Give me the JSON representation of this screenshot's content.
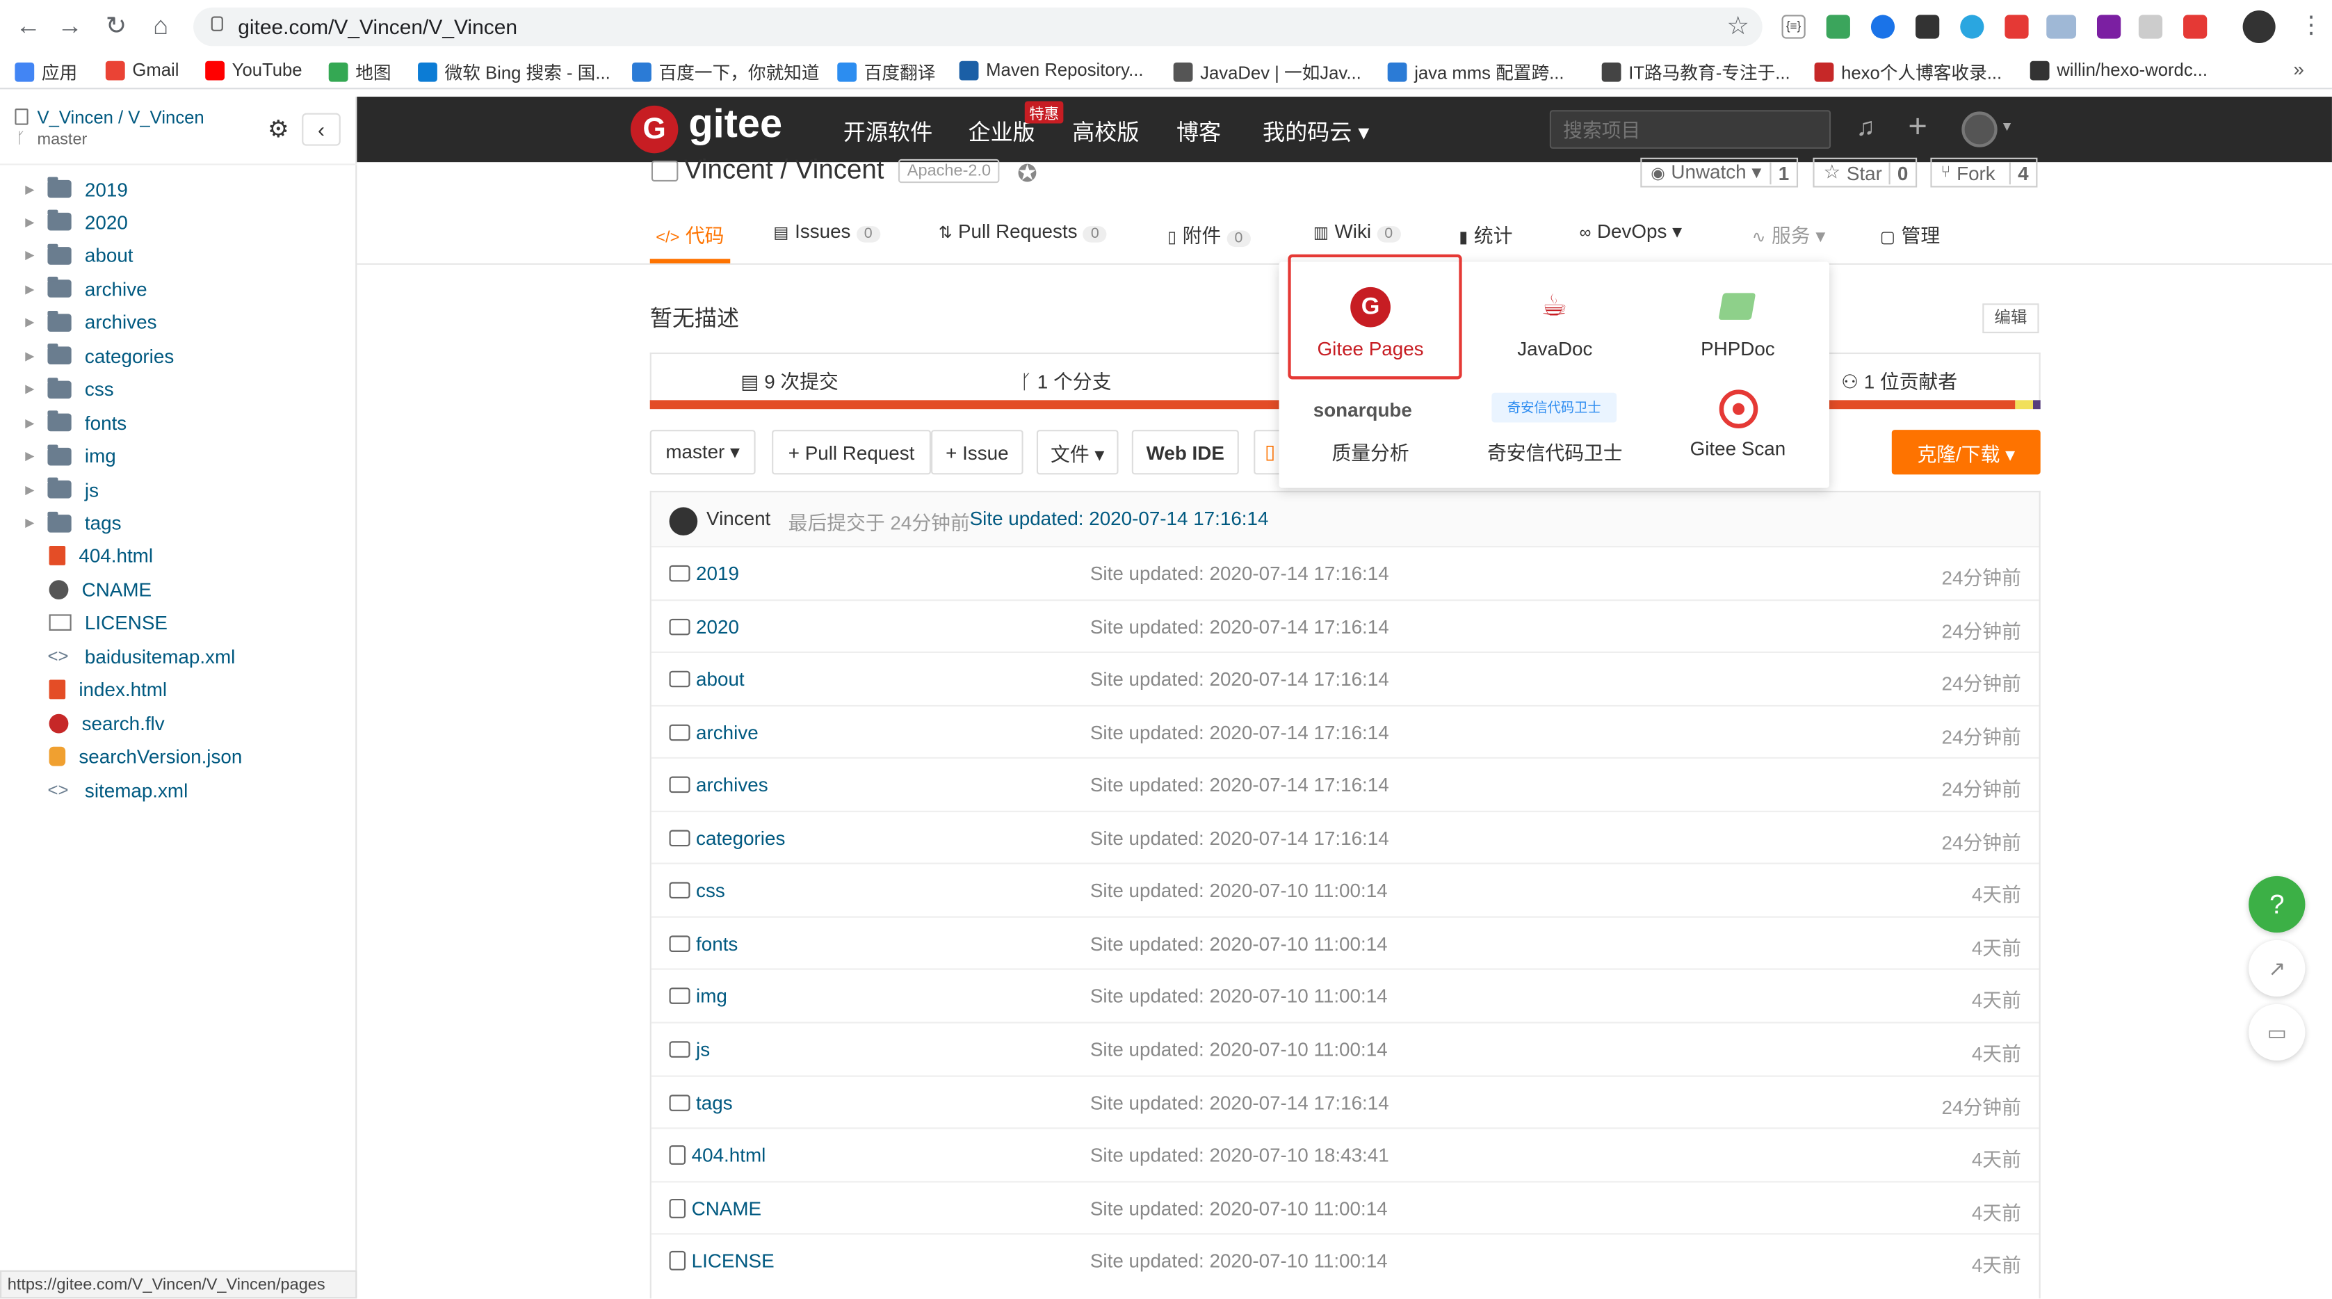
{
  "browser": {
    "url": "gitee.com/V_Vincen/V_Vincen",
    "status_url": "https://gitee.com/V_Vincen/V_Vincen/pages",
    "bookmarks": [
      "应用",
      "Gmail",
      "YouTube",
      "地图",
      "微软 Bing 搜索 - 国...",
      "百度一下，你就知道",
      "百度翻译",
      "Maven Repository...",
      "JavaDev | 一如Jav...",
      "java mms 配置跨...",
      "IT路马教育-专注于...",
      "hexo个人博客收录...",
      "willin/hexo-wordc..."
    ],
    "more": "»"
  },
  "sidebar": {
    "repo_path": "V_Vincen / V_Vincen",
    "branch": "master",
    "tree": [
      {
        "name": "2019",
        "type": "folder"
      },
      {
        "name": "2020",
        "type": "folder"
      },
      {
        "name": "about",
        "type": "folder"
      },
      {
        "name": "archive",
        "type": "folder"
      },
      {
        "name": "archives",
        "type": "folder"
      },
      {
        "name": "categories",
        "type": "folder"
      },
      {
        "name": "css",
        "type": "folder"
      },
      {
        "name": "fonts",
        "type": "folder"
      },
      {
        "name": "img",
        "type": "folder"
      },
      {
        "name": "js",
        "type": "folder"
      },
      {
        "name": "tags",
        "type": "folder"
      },
      {
        "name": "404.html",
        "type": "html"
      },
      {
        "name": "CNAME",
        "type": "globe"
      },
      {
        "name": "LICENSE",
        "type": "book"
      },
      {
        "name": "baidusitemap.xml",
        "type": "code"
      },
      {
        "name": "index.html",
        "type": "html"
      },
      {
        "name": "search.flv",
        "type": "media"
      },
      {
        "name": "searchVersion.json",
        "type": "db"
      },
      {
        "name": "sitemap.xml",
        "type": "code"
      }
    ]
  },
  "header": {
    "logo": "gitee",
    "nav": [
      "开源软件",
      "企业版",
      "高校版",
      "博客",
      "我的码云 ▾"
    ],
    "promo_badge": "特惠",
    "search_placeholder": "搜索项目"
  },
  "project": {
    "title": "Vincent / Vincent",
    "license": "Apache-2.0",
    "unwatch": "Unwatch ▾",
    "unwatch_count": "1",
    "star": "Star",
    "star_count": "0",
    "fork": "Fork",
    "fork_count": "4",
    "tabs": [
      {
        "label": "代码",
        "count": ""
      },
      {
        "label": "Issues",
        "count": "0"
      },
      {
        "label": "Pull Requests",
        "count": "0"
      },
      {
        "label": "附件",
        "count": "0"
      },
      {
        "label": "Wiki",
        "count": "0"
      },
      {
        "label": "统计",
        "count": ""
      },
      {
        "label": "DevOps ▾",
        "count": ""
      },
      {
        "label": "服务 ▾",
        "count": ""
      },
      {
        "label": "管理",
        "count": ""
      }
    ],
    "description": "暂无描述",
    "edit": "编辑",
    "commits": "9 次提交",
    "branches": "1 个分支",
    "contributors": "1 位贡献者",
    "branch_select": "master ▾",
    "pull_request_btn": "+ Pull Request",
    "issue_btn": "+ Issue",
    "files_btn": "文件 ▾",
    "webide_btn": "Web IDE",
    "clone_btn": "克隆/下载 ▾"
  },
  "dropdown": {
    "items": [
      {
        "label": "Gitee Pages",
        "selected": true
      },
      {
        "label": "JavaDoc"
      },
      {
        "label": "PHPDoc"
      },
      {
        "label": "质量分析",
        "logo": "sonarqube"
      },
      {
        "label": "奇安信代码卫士",
        "logo": "奇安信代码卫士"
      },
      {
        "label": "Gitee Scan"
      }
    ]
  },
  "commit": {
    "author": "Vincent",
    "text": "最后提交于 24分钟前",
    "message": "Site updated: 2020-07-14 17:16:14"
  },
  "files": [
    {
      "name": "2019",
      "type": "folder",
      "message": "Site updated: 2020-07-14 17:16:14",
      "time": "24分钟前"
    },
    {
      "name": "2020",
      "type": "folder",
      "message": "Site updated: 2020-07-14 17:16:14",
      "time": "24分钟前"
    },
    {
      "name": "about",
      "type": "folder",
      "message": "Site updated: 2020-07-14 17:16:14",
      "time": "24分钟前"
    },
    {
      "name": "archive",
      "type": "folder",
      "message": "Site updated: 2020-07-14 17:16:14",
      "time": "24分钟前"
    },
    {
      "name": "archives",
      "type": "folder",
      "message": "Site updated: 2020-07-14 17:16:14",
      "time": "24分钟前"
    },
    {
      "name": "categories",
      "type": "folder",
      "message": "Site updated: 2020-07-14 17:16:14",
      "time": "24分钟前"
    },
    {
      "name": "css",
      "type": "folder",
      "message": "Site updated: 2020-07-10 11:00:14",
      "time": "4天前"
    },
    {
      "name": "fonts",
      "type": "folder",
      "message": "Site updated: 2020-07-10 11:00:14",
      "time": "4天前"
    },
    {
      "name": "img",
      "type": "folder",
      "message": "Site updated: 2020-07-10 11:00:14",
      "time": "4天前"
    },
    {
      "name": "js",
      "type": "folder",
      "message": "Site updated: 2020-07-10 11:00:14",
      "time": "4天前"
    },
    {
      "name": "tags",
      "type": "folder",
      "message": "Site updated: 2020-07-14 17:16:14",
      "time": "24分钟前"
    },
    {
      "name": "404.html",
      "type": "file",
      "message": "Site updated: 2020-07-10 18:43:41",
      "time": "4天前"
    },
    {
      "name": "CNAME",
      "type": "file",
      "message": "Site updated: 2020-07-10 11:00:14",
      "time": "4天前"
    },
    {
      "name": "LICENSE",
      "type": "file",
      "message": "Site updated: 2020-07-10 11:00:14",
      "time": "4天前"
    }
  ],
  "float_help": "?",
  "colors": {
    "brand": "#c71d23",
    "clone": "#fe7300",
    "header": "#2a2a2a",
    "link": "#005980"
  }
}
